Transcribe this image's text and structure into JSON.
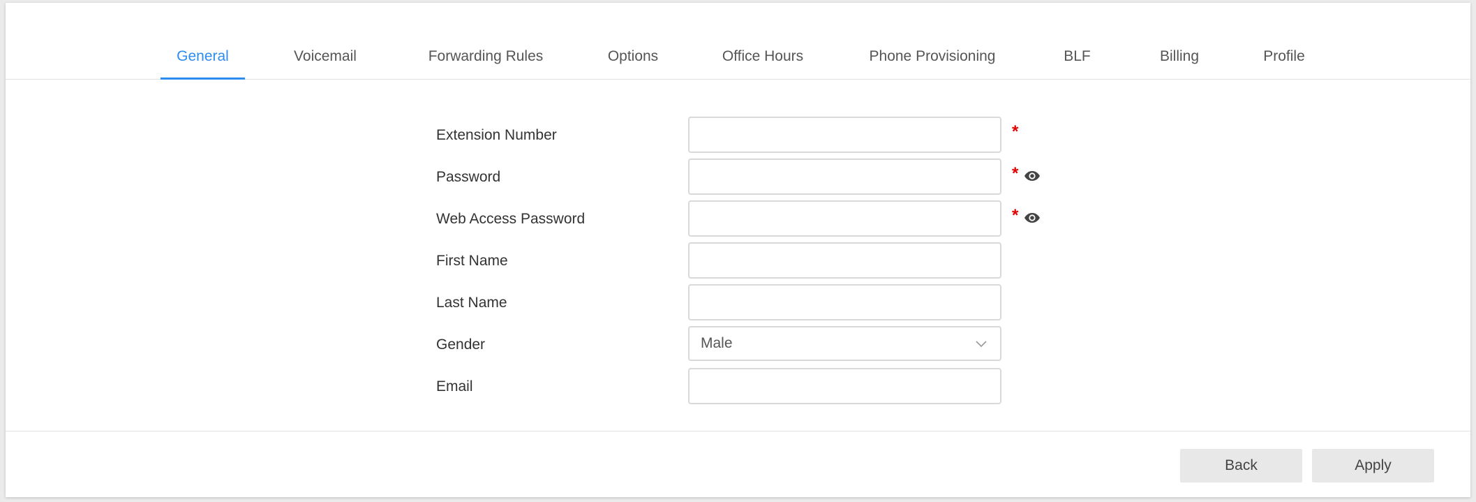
{
  "tabs": [
    {
      "label": "General",
      "active": true
    },
    {
      "label": "Voicemail"
    },
    {
      "label": "Forwarding Rules"
    },
    {
      "label": "Options"
    },
    {
      "label": "Office Hours"
    },
    {
      "label": "Phone Provisioning"
    },
    {
      "label": "BLF"
    },
    {
      "label": "Billing"
    },
    {
      "label": "Profile"
    }
  ],
  "form": {
    "extension_number": {
      "label": "Extension Number",
      "value": "",
      "required": true
    },
    "password": {
      "label": "Password",
      "value": "",
      "required": true,
      "icon": "eye-icon"
    },
    "web_access_password": {
      "label": "Web Access Password",
      "value": "",
      "required": true,
      "icon": "eye-icon"
    },
    "first_name": {
      "label": "First Name",
      "value": ""
    },
    "last_name": {
      "label": "Last Name",
      "value": ""
    },
    "gender": {
      "label": "Gender",
      "value": "Male",
      "icon": "chevron-down-icon"
    },
    "email": {
      "label": "Email",
      "value": ""
    },
    "required_marker": "*"
  },
  "buttons": {
    "back": "Back",
    "apply": "Apply"
  },
  "colors": {
    "accent": "#2d8cf0",
    "required": "#e00000",
    "button_bg": "#e8e8e8"
  }
}
